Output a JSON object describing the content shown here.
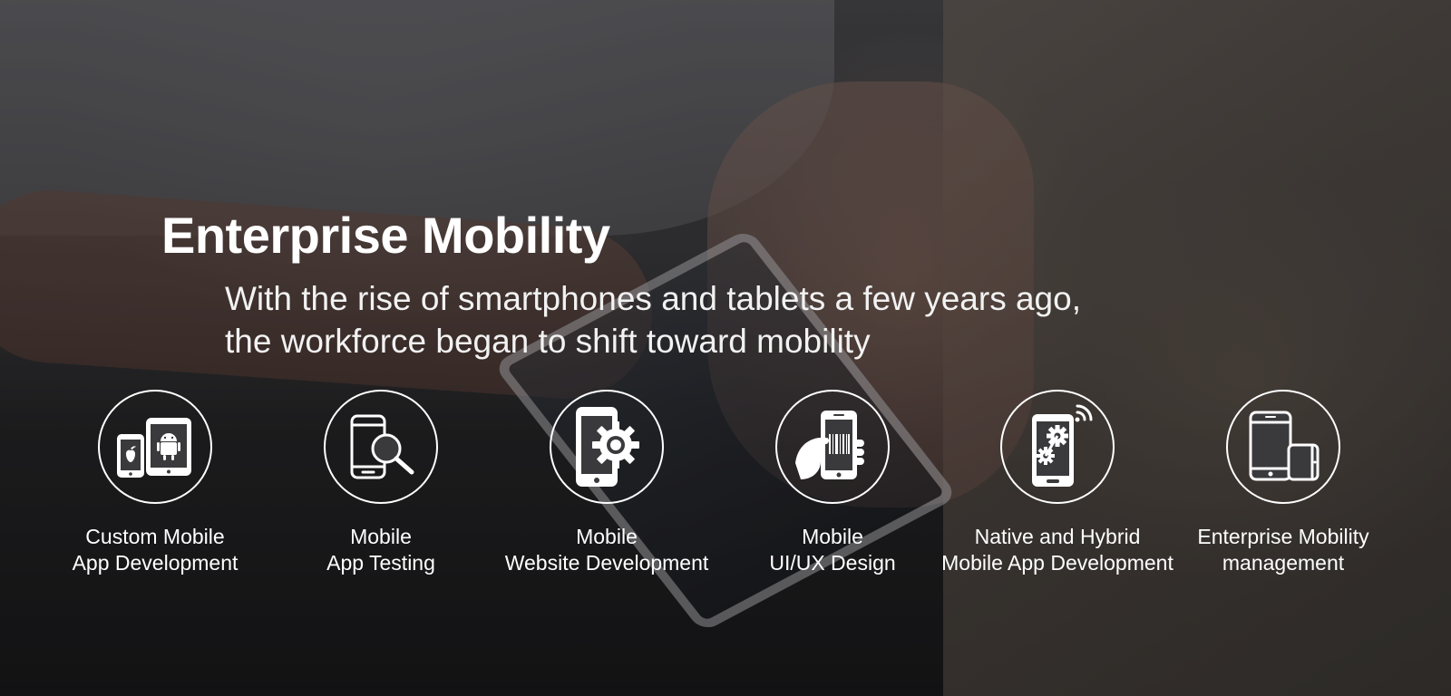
{
  "hero": {
    "title": "Enterprise Mobility",
    "subtitle_line1": "With the rise of smartphones and tablets a few years ago,",
    "subtitle_line2": "the workforce began to shift toward mobility"
  },
  "services": [
    {
      "icon": "phone-tablet-apple-android-icon",
      "line1": "Custom Mobile",
      "line2": "App Development"
    },
    {
      "icon": "phone-magnifier-icon",
      "line1": "Mobile",
      "line2": "App Testing"
    },
    {
      "icon": "phone-gear-icon",
      "line1": "Mobile",
      "line2": "Website Development"
    },
    {
      "icon": "hand-holding-phone-icon",
      "line1": "Mobile",
      "line2": "UI/UX Design"
    },
    {
      "icon": "phone-gears-wifi-icon",
      "line1": "Native and Hybrid",
      "line2": "Mobile App Development"
    },
    {
      "icon": "phone-tablet-devices-icon",
      "line1": "Enterprise Mobility",
      "line2": "management"
    }
  ],
  "colors": {
    "text": "#ffffff",
    "overlay": "#000000"
  }
}
